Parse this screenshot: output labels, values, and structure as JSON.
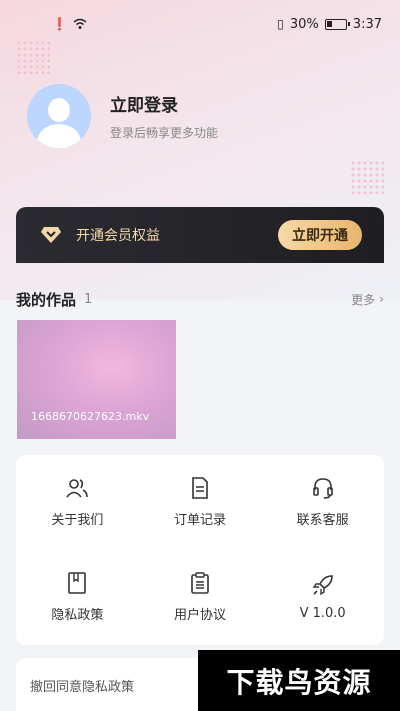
{
  "status_bar": {
    "battery_percent": "30%",
    "battery_level": 0.3,
    "time": "3:37",
    "icons": [
      "alert-icon",
      "wifi-icon",
      "vibrate-icon",
      "battery-icon"
    ]
  },
  "profile": {
    "login_title": "立即登录",
    "login_subtitle": "登录后畅享更多功能",
    "avatar_icon": "user-avatar-icon"
  },
  "vip": {
    "label": "开通会员权益",
    "button_label": "立即开通",
    "icon": "diamond-icon",
    "colors": {
      "bg": "#242329",
      "text": "#f3d9a7",
      "button": "#e8b56c"
    }
  },
  "works": {
    "title": "我的作品",
    "count": "1",
    "more_label": "更多",
    "items": [
      {
        "name": "1668670627623.mkv"
      }
    ]
  },
  "menu": {
    "items": [
      {
        "label": "关于我们",
        "icon": "users-icon"
      },
      {
        "label": "订单记录",
        "icon": "document-icon"
      },
      {
        "label": "联系客服",
        "icon": "headset-icon"
      },
      {
        "label": "隐私政策",
        "icon": "book-icon"
      },
      {
        "label": "用户协议",
        "icon": "clipboard-icon"
      },
      {
        "label": "V 1.0.0",
        "icon": "rocket-icon"
      }
    ]
  },
  "revoke": {
    "label": "撤回同意隐私政策"
  },
  "watermark": {
    "text": "下载鸟资源"
  }
}
